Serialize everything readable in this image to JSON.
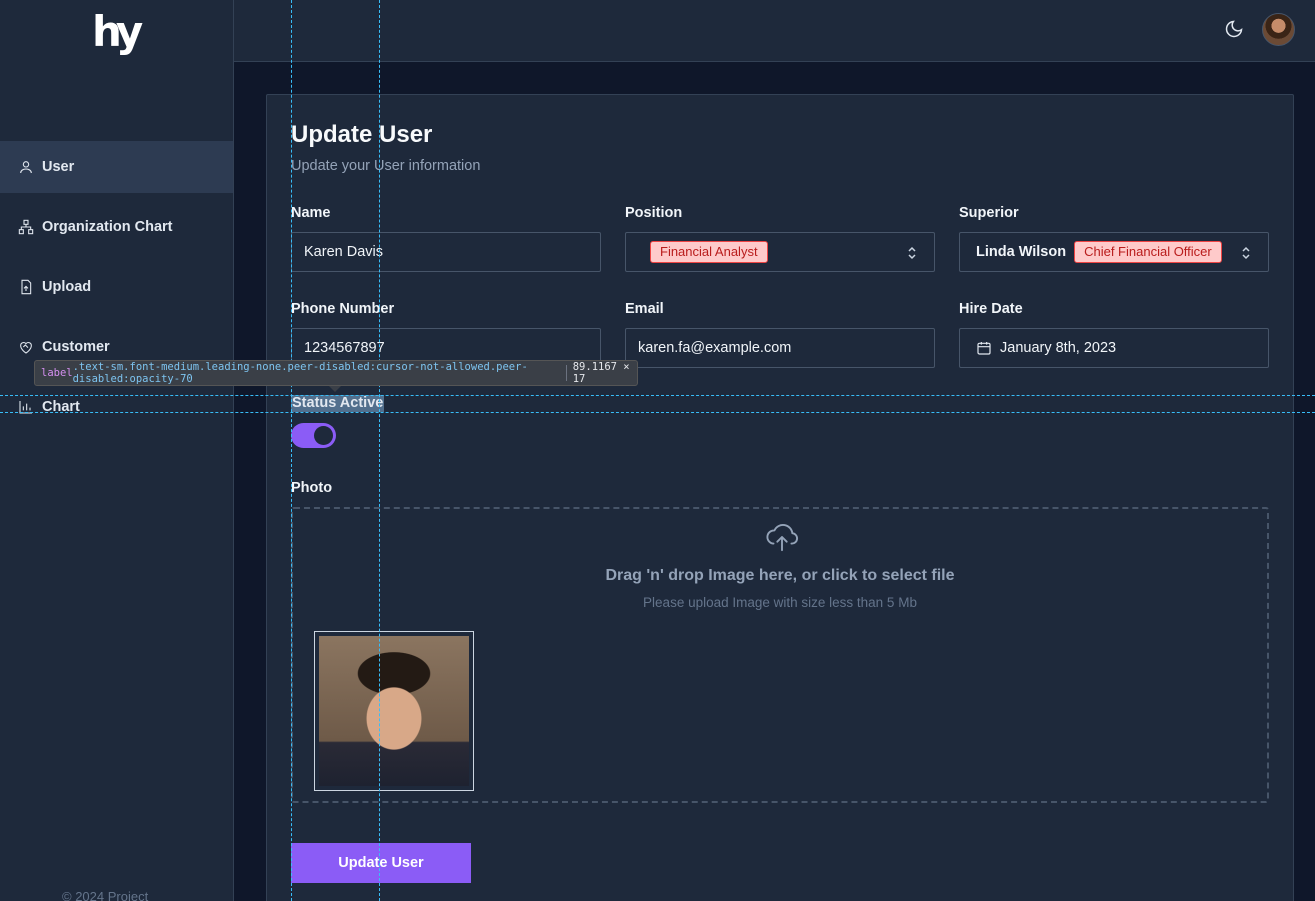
{
  "sidebar": {
    "logo": "hy",
    "items": [
      {
        "label": "User",
        "icon": "user-icon",
        "active": true
      },
      {
        "label": "Organization Chart",
        "icon": "org-chart-icon",
        "active": false
      },
      {
        "label": "Upload",
        "icon": "file-upload-icon",
        "active": false
      },
      {
        "label": "Customer",
        "icon": "heart-handshake-icon",
        "active": false
      },
      {
        "label": "Chart",
        "icon": "bar-chart-icon",
        "active": false
      }
    ],
    "footer": "© 2024 Project"
  },
  "header": {
    "theme_icon": "moon-icon",
    "avatar": "user-avatar"
  },
  "form": {
    "title": "Update User",
    "subtitle": "Update your User information",
    "name": {
      "label": "Name",
      "value": "Karen Davis"
    },
    "position": {
      "label": "Position",
      "value": "Financial Analyst"
    },
    "superior": {
      "label": "Superior",
      "name": "Linda Wilson",
      "badge": "Chief Financial Officer"
    },
    "phone": {
      "label": "Phone Number",
      "value": "1234567897"
    },
    "email": {
      "label": "Email",
      "value": "karen.fa@example.com"
    },
    "hire_date": {
      "label": "Hire Date",
      "value": "January 8th, 2023"
    },
    "status": {
      "label": "Status Active",
      "active": true
    },
    "photo": {
      "label": "Photo",
      "drop_text": "Drag 'n' drop Image here, or click to select file",
      "hint": "Please upload Image with size less than 5 Mb"
    },
    "submit_label": "Update User"
  },
  "devtools": {
    "tag": "label",
    "classes": ".text-sm.font-medium.leading-none.peer-disabled:cursor-not-allowed.peer-disabled:opacity-70",
    "dimensions": "89.1167 × 17"
  },
  "colors": {
    "accent": "#8b5cf6",
    "badge_bg": "#fecaca",
    "badge_text": "#b91c1c",
    "panel": "#1e293b",
    "background": "#0f172a"
  }
}
